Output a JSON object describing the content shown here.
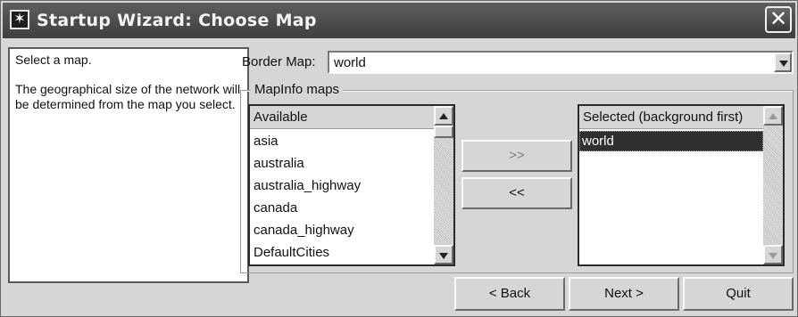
{
  "window": {
    "title": "Startup Wizard: Choose Map",
    "close_glyph": "✕"
  },
  "description": {
    "line1": "Select a map.",
    "line2": "The geographical size of the network will be determined from the map you select."
  },
  "border_map": {
    "label": "Border Map:",
    "value": "world"
  },
  "group": {
    "label": "MapInfo maps"
  },
  "available": {
    "header": "Available",
    "items": [
      "asia",
      "australia",
      "australia_highway",
      "canada",
      "canada_highway",
      "DefaultCities"
    ]
  },
  "selected": {
    "header": "Selected (background first)",
    "items": [
      "world"
    ]
  },
  "buttons": {
    "add": ">>",
    "remove": "<<",
    "back": "< Back",
    "next": "Next >",
    "quit": "Quit"
  },
  "icons": {
    "title": "star-icon",
    "close": "close-icon"
  }
}
